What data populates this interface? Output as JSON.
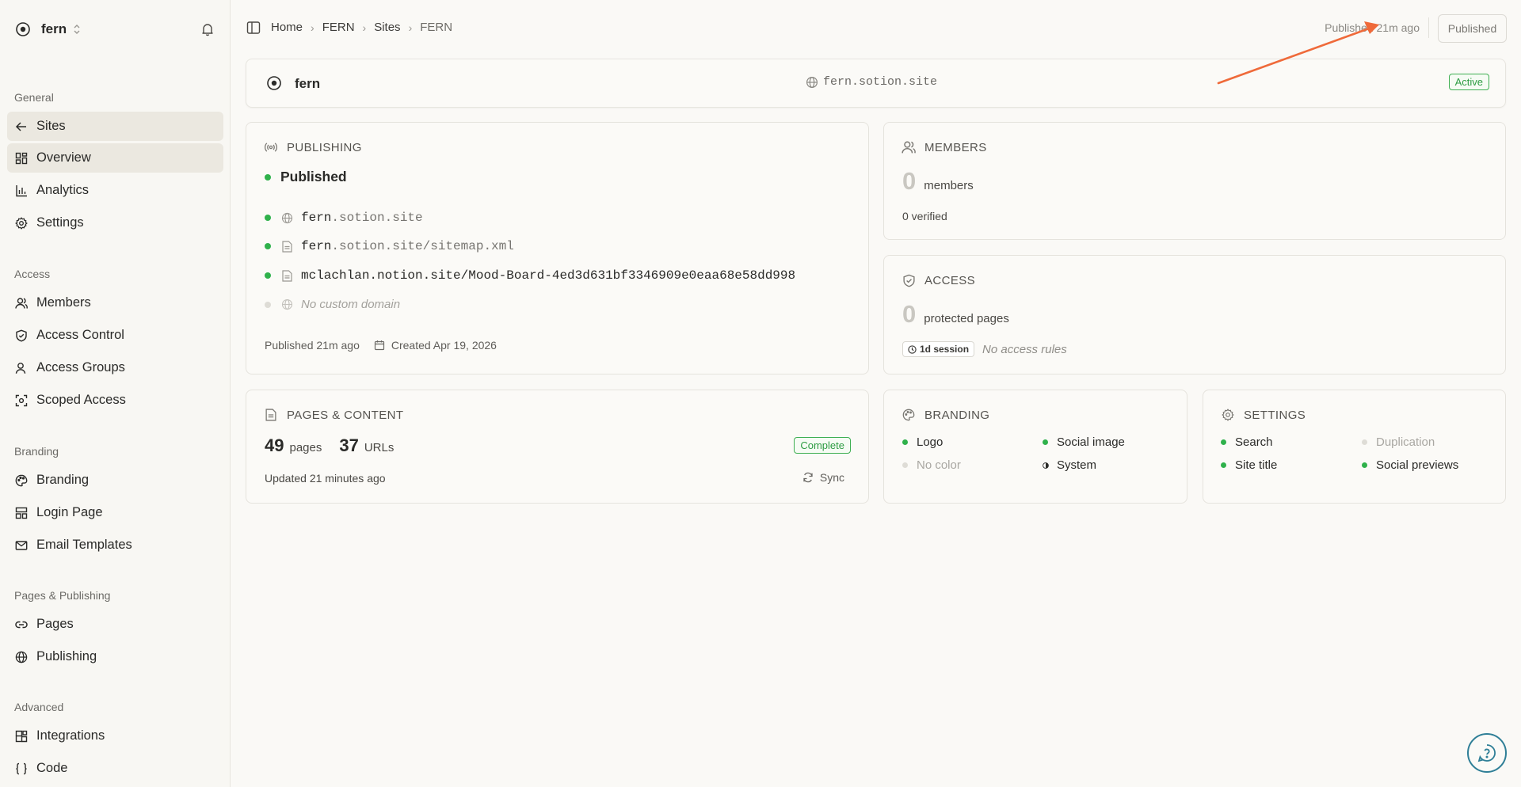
{
  "workspace": {
    "name": "fern"
  },
  "sidebar": {
    "groups": [
      {
        "label": "General",
        "items": [
          {
            "label": "Sites",
            "icon": "arrow-left-icon"
          },
          {
            "label": "Overview",
            "icon": "grid-icon"
          },
          {
            "label": "Analytics",
            "icon": "bar-chart-icon"
          },
          {
            "label": "Settings",
            "icon": "gear-icon"
          }
        ]
      },
      {
        "label": "Access",
        "items": [
          {
            "label": "Members",
            "icon": "user-icon"
          },
          {
            "label": "Access Control",
            "icon": "shield-icon"
          },
          {
            "label": "Access Groups",
            "icon": "users-icon"
          },
          {
            "label": "Scoped Access",
            "icon": "scope-icon"
          }
        ]
      },
      {
        "label": "Branding",
        "items": [
          {
            "label": "Branding",
            "icon": "palette-icon"
          },
          {
            "label": "Login Page",
            "icon": "layout-icon"
          },
          {
            "label": "Email Templates",
            "icon": "mail-icon"
          }
        ]
      },
      {
        "label": "Pages & Publishing",
        "items": [
          {
            "label": "Pages",
            "icon": "link-icon"
          },
          {
            "label": "Publishing",
            "icon": "globe-icon"
          }
        ]
      },
      {
        "label": "Advanced",
        "items": [
          {
            "label": "Integrations",
            "icon": "blocks-icon"
          },
          {
            "label": "Code",
            "icon": "braces-icon"
          }
        ]
      }
    ]
  },
  "breadcrumb": [
    "Home",
    "FERN",
    "Sites",
    "FERN"
  ],
  "header": {
    "published_time": "Published 21m ago",
    "publish_button": "Published"
  },
  "site": {
    "name": "fern",
    "domain": "fern.sotion.site",
    "status": "Active"
  },
  "publishing": {
    "title": "PUBLISHING",
    "status": "Published",
    "urls": [
      {
        "prefix": "fern",
        "rest": ".sotion.site",
        "icon": "globe-icon"
      },
      {
        "prefix": "fern",
        "rest": ".sotion.site/sitemap.xml",
        "icon": "file-icon"
      },
      {
        "prefix": "mclachlan.notion.site/Mood-Board-4ed3d631bf3346909e0eaa68e58dd998",
        "rest": "",
        "icon": "file-icon"
      }
    ],
    "no_custom_domain": "No custom domain",
    "published_ago": "Published 21m ago",
    "created": "Created Apr 19, 2026"
  },
  "members": {
    "title": "MEMBERS",
    "count": "0",
    "count_label": "members",
    "verified": "0 verified"
  },
  "access": {
    "title": "ACCESS",
    "count": "0",
    "count_label": "protected pages",
    "session": "1d session",
    "rules": "No access rules"
  },
  "pages_content": {
    "title": "PAGES & CONTENT",
    "pages": "49",
    "pages_label": "pages",
    "urls": "37",
    "urls_label": "URLs",
    "status": "Complete",
    "updated": "Updated 21 minutes ago",
    "sync": "Sync"
  },
  "branding": {
    "title": "BRANDING",
    "items": [
      {
        "label": "Logo",
        "state": "on"
      },
      {
        "label": "Social image",
        "state": "on"
      },
      {
        "label": "No color",
        "state": "off"
      },
      {
        "label": "System",
        "state": "half"
      }
    ]
  },
  "settings": {
    "title": "SETTINGS",
    "items": [
      {
        "label": "Search",
        "state": "on"
      },
      {
        "label": "Duplication",
        "state": "off"
      },
      {
        "label": "Site title",
        "state": "on"
      },
      {
        "label": "Social previews",
        "state": "on"
      }
    ]
  },
  "colors": {
    "accent_green": "#2fb14b",
    "annotation_arrow": "#ef6a3a",
    "help_ring": "#2f7f97"
  }
}
